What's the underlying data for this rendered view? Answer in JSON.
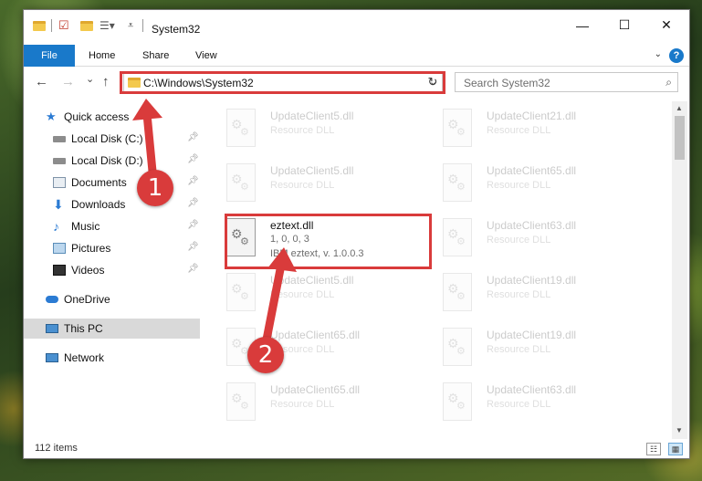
{
  "window": {
    "title": "System32"
  },
  "window_controls": {
    "minimize": "—",
    "maximize": "☐",
    "close": "✕"
  },
  "ribbon": {
    "file": "File",
    "tabs": [
      "Home",
      "Share",
      "View"
    ],
    "help": "?"
  },
  "navigation": {
    "back": "←",
    "forward": "→",
    "recent": "⌄",
    "up": "↑",
    "address": "C:\\Windows\\System32",
    "search_placeholder": "Search System32",
    "refresh": "↻"
  },
  "sidebar": {
    "items": [
      {
        "label": "Quick access",
        "icon": "star-icon"
      },
      {
        "label": "Local Disk (C:)",
        "icon": "drive-icon"
      },
      {
        "label": "Local Disk (D:)",
        "icon": "drive-icon"
      },
      {
        "label": "Documents",
        "icon": "documents-icon"
      },
      {
        "label": "Downloads",
        "icon": "download-icon"
      },
      {
        "label": "Music",
        "icon": "music-icon"
      },
      {
        "label": "Pictures",
        "icon": "pictures-icon"
      },
      {
        "label": "Videos",
        "icon": "videos-icon"
      },
      {
        "label": "OneDrive",
        "icon": "cloud-icon"
      },
      {
        "label": "This PC",
        "icon": "computer-icon"
      },
      {
        "label": "Network",
        "icon": "network-icon"
      }
    ]
  },
  "files": {
    "left": [
      {
        "name": "UpdateClient5.dll",
        "desc": "Resource DLL"
      },
      {
        "name": "UpdateClient5.dll",
        "desc": "Resource DLL"
      },
      {
        "name": "eztext.dll",
        "version": "1, 0, 0, 3",
        "desc": "IBM eztext, v. 1.0.0.3"
      },
      {
        "name": "UpdateClient5.dll",
        "desc": "Resource DLL"
      },
      {
        "name": "UpdateClient65.dll",
        "desc": "Resource DLL"
      },
      {
        "name": "UpdateClient65.dll",
        "desc": "Resource DLL"
      }
    ],
    "right": [
      {
        "name": "UpdateClient21.dll",
        "desc": "Resource DLL"
      },
      {
        "name": "UpdateClient65.dll",
        "desc": "Resource DLL"
      },
      {
        "name": "UpdateClient63.dll",
        "desc": "Resource DLL"
      },
      {
        "name": "UpdateClient19.dll",
        "desc": "Resource DLL"
      },
      {
        "name": "UpdateClient19.dll",
        "desc": "Resource DLL"
      },
      {
        "name": "UpdateClient63.dll",
        "desc": "Resource DLL"
      }
    ]
  },
  "status": {
    "count": "112 items"
  },
  "annotations": {
    "step1": "1",
    "step2": "2"
  },
  "colors": {
    "accent": "#1979ca",
    "highlight": "#d93b3b",
    "selected": "#d9d9d9"
  }
}
